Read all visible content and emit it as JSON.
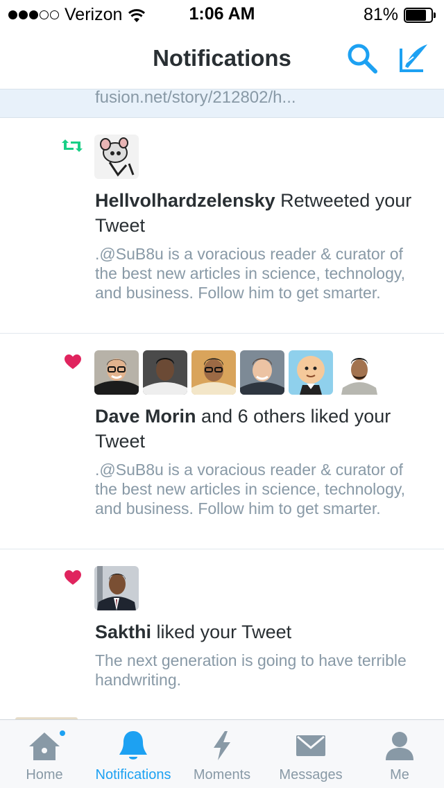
{
  "status_bar": {
    "carrier": "Verizon",
    "time": "1:06 AM",
    "battery": "81%",
    "battery_level": 0.81,
    "signal_filled": 3,
    "signal_total": 5
  },
  "nav": {
    "title": "Notifications"
  },
  "partial_top": {
    "text": "fusion.net/story/212802/h..."
  },
  "notifications": [
    {
      "type": "retweet",
      "actor": "Hellvolhardzelensky",
      "action": " Retweeted your Tweet",
      "body": ".@SuB8u is a voracious reader & curator of the best new articles in science, technology, and business. Follow him to get smarter."
    },
    {
      "type": "like",
      "actor": "Dave Morin",
      "action": " and 6 others liked your Tweet",
      "body": ".@SuB8u is a voracious reader & curator of the best new articles in science, technology, and business. Follow him to get smarter."
    },
    {
      "type": "like",
      "actor": "Sakthi",
      "action": " liked your Tweet",
      "body": "The next generation is going to have terrible handwriting."
    }
  ],
  "tabs": [
    {
      "label": "Home",
      "icon": "home-icon"
    },
    {
      "label": "Notifications",
      "icon": "bell-icon",
      "active": true
    },
    {
      "label": "Moments",
      "icon": "lightning-icon"
    },
    {
      "label": "Messages",
      "icon": "envelope-icon"
    },
    {
      "label": "Me",
      "icon": "person-icon"
    }
  ],
  "colors": {
    "accent": "#1da1f2",
    "retweet": "#19cf86",
    "like": "#e0245e",
    "muted": "#8899a6",
    "text": "#292f33"
  }
}
